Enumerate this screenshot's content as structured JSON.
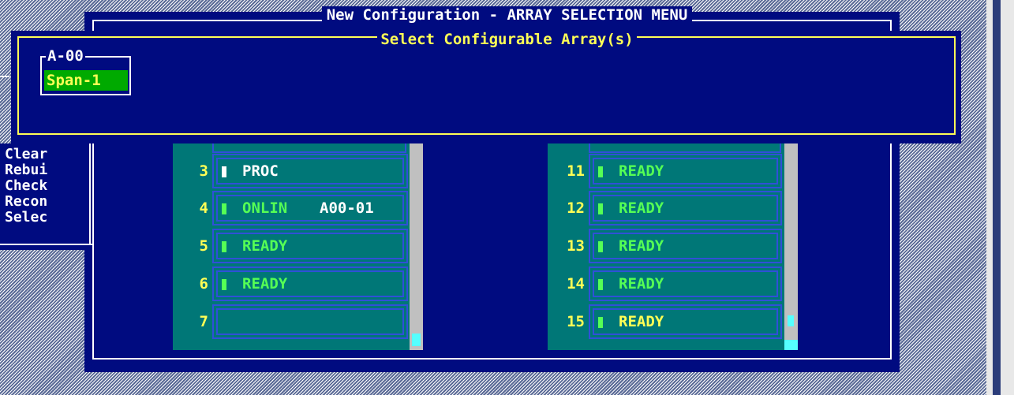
{
  "window": {
    "title": "New Configuration - ARRAY SELECTION MENU"
  },
  "left_menu": {
    "items": [
      {
        "label": "Clear"
      },
      {
        "label": "Rebui"
      },
      {
        "label": "Check"
      },
      {
        "label": "Recon"
      },
      {
        "label": "Selec"
      }
    ]
  },
  "dialog": {
    "title": "Select Configurable Array(s)",
    "array_group_label": "A-00",
    "span_label": "Span-1"
  },
  "channel_left": {
    "rows": [
      {
        "num": "3",
        "status": "PROC",
        "assignment": "",
        "status_color": "#ffffff"
      },
      {
        "num": "4",
        "status": "ONLIN",
        "assignment": "A00-01",
        "status_color": "#55ff55"
      },
      {
        "num": "5",
        "status": "READY",
        "assignment": "",
        "status_color": "#55ff55"
      },
      {
        "num": "6",
        "status": "READY",
        "assignment": "",
        "status_color": "#55ff55"
      },
      {
        "num": "7",
        "status": "",
        "assignment": "",
        "status_color": ""
      }
    ]
  },
  "channel_right": {
    "rows": [
      {
        "num": "11",
        "status": "READY",
        "assignment": "",
        "status_color": "#55ff55"
      },
      {
        "num": "12",
        "status": "READY",
        "assignment": "",
        "status_color": "#55ff55"
      },
      {
        "num": "13",
        "status": "READY",
        "assignment": "",
        "status_color": "#55ff55"
      },
      {
        "num": "14",
        "status": "READY",
        "assignment": "",
        "status_color": "#55ff55"
      },
      {
        "num": "15",
        "status": "READY",
        "assignment": "",
        "status_color": "#ffff55"
      }
    ]
  },
  "colors": {
    "background_navy": "#000b80",
    "panel_teal": "#007777",
    "highlight_yellow": "#ffff55",
    "ready_green": "#55ff55"
  }
}
